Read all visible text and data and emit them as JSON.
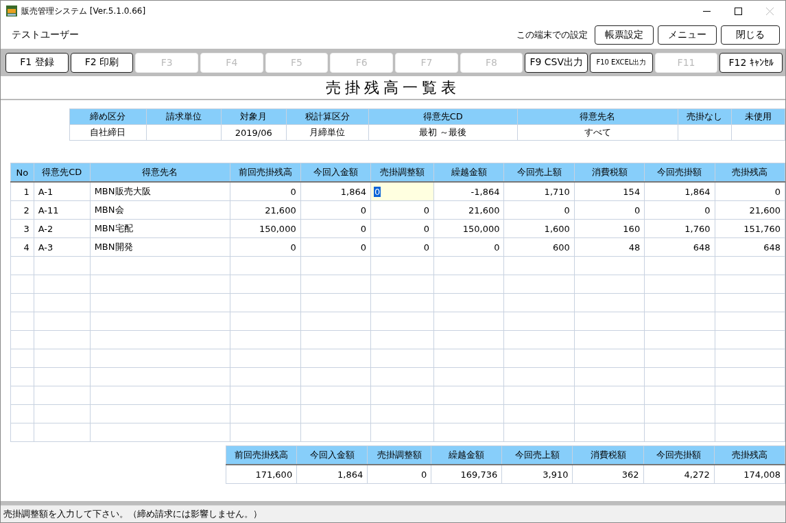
{
  "window": {
    "title": "販売管理システム [Ver.5.1.0.66]",
    "close_disabled": true
  },
  "header": {
    "user": "テストユーザー",
    "settings_label": "この端末での設定",
    "buttons": [
      "帳票設定",
      "メニュー",
      "閉じる"
    ]
  },
  "function_keys": [
    {
      "label": "F1 登録",
      "disabled": false,
      "kind": "normal"
    },
    {
      "label": "F2 印刷",
      "disabled": false,
      "kind": "normal"
    },
    {
      "label": "F3",
      "disabled": true,
      "kind": "normal"
    },
    {
      "label": "F4",
      "disabled": true,
      "kind": "normal"
    },
    {
      "label": "F5",
      "disabled": true,
      "kind": "normal"
    },
    {
      "label": "F6",
      "disabled": true,
      "kind": "normal"
    },
    {
      "label": "F7",
      "disabled": true,
      "kind": "normal"
    },
    {
      "label": "F8",
      "disabled": true,
      "kind": "normal"
    },
    {
      "label": "F9 CSV出力",
      "disabled": false,
      "kind": "normal"
    },
    {
      "label": "F10 EXCEL出力",
      "disabled": false,
      "kind": "compact"
    },
    {
      "label": "F11",
      "disabled": true,
      "kind": "normal"
    },
    {
      "label": "F12 ｷｬﾝｾﾙ",
      "disabled": false,
      "kind": "normal"
    }
  ],
  "report_title": "売掛残高一覧表",
  "conditions": [
    {
      "label": "締め区分",
      "value": "自社締日"
    },
    {
      "label": "請求単位"
    },
    {
      "label": "対象月",
      "value": "2019/06"
    },
    {
      "label": "税計算区分",
      "value": "月締単位"
    },
    {
      "label": "得意先CD",
      "value": "最初 ～最後"
    },
    {
      "label": "得意先名",
      "value": "すべて"
    },
    {
      "label": "売掛なし"
    },
    {
      "label": "未使用"
    }
  ],
  "table": {
    "columns": [
      "No",
      "得意先CD",
      "得意先名",
      "前回売掛残高",
      "今回入金額",
      "売掛調整額",
      "繰越金額",
      "今回売上額",
      "消費税額",
      "今回売掛額",
      "売掛残高"
    ],
    "rows": [
      {
        "cells": [
          "1",
          "A-1",
          "MBN販売大阪",
          "0",
          "1,864",
          "0",
          "-1,864",
          "1,710",
          "154",
          "1,864",
          "0"
        ],
        "editing": true
      },
      {
        "cells": [
          "2",
          "A-11",
          "MBN会",
          "21,600",
          "0",
          "0",
          "21,600",
          "0",
          "0",
          "0",
          "21,600"
        ],
        "editing": false
      },
      {
        "cells": [
          "3",
          "A-2",
          "MBN宅配",
          "150,000",
          "0",
          "0",
          "150,000",
          "1,600",
          "160",
          "1,760",
          "151,760"
        ],
        "editing": false
      },
      {
        "cells": [
          "4",
          "A-3",
          "MBN開発",
          "0",
          "0",
          "0",
          "0",
          "600",
          "48",
          "648",
          "648"
        ],
        "editing": false
      }
    ]
  },
  "totals": {
    "columns": [
      "前回売掛残高",
      "今回入金額",
      "売掛調整額",
      "繰越金額",
      "今回売上額",
      "消費税額",
      "今回売掛額",
      "売掛残高"
    ],
    "values": [
      "171,600",
      "1,864",
      "0",
      "169,736",
      "3,910",
      "362",
      "4,272",
      "174,008"
    ]
  },
  "status_bar": "売掛調整額を入力して下さい。（締め請求には影響しません。）"
}
